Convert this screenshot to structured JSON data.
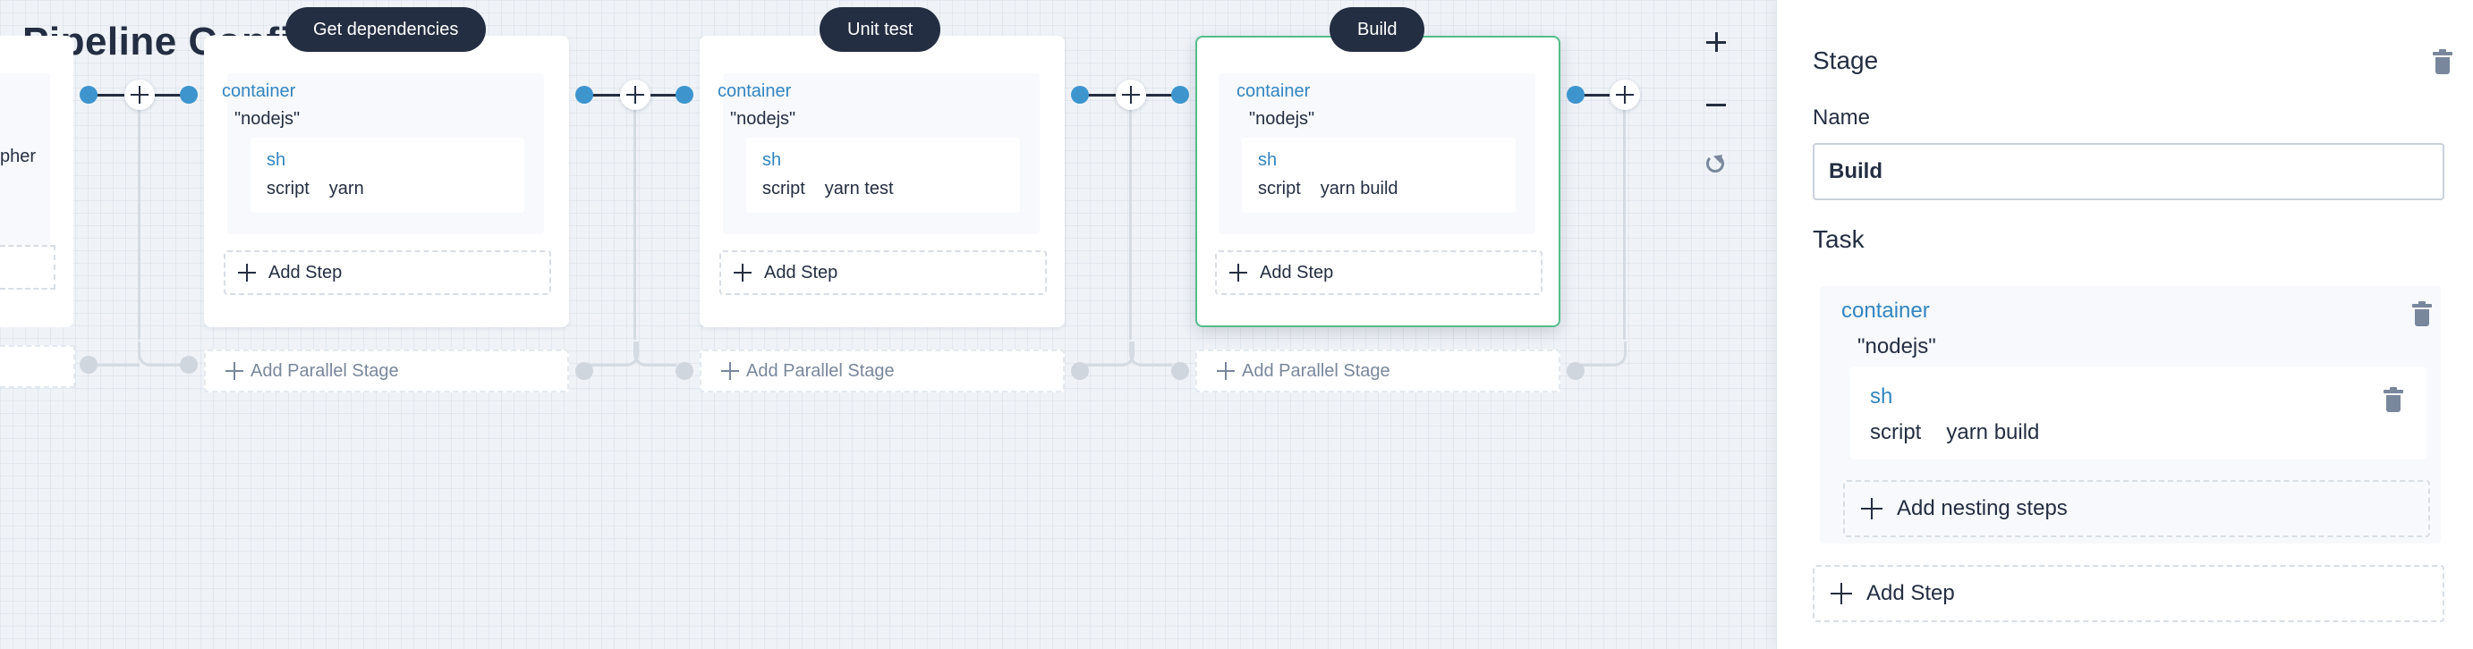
{
  "canvas": {
    "title_partial": "Pipeline Configuration",
    "zoom_in_label": "+",
    "zoom_out_label": "−",
    "partial_stage": {
      "text": "pher"
    },
    "stages": [
      {
        "name": "Get dependencies",
        "task_title": "container",
        "task_value": "\"nodejs\"",
        "step_title": "sh",
        "step_key": "script",
        "step_value": "yarn",
        "add_step": "Add Step",
        "add_parallel": "Add Parallel Stage",
        "selected": false
      },
      {
        "name": "Unit test",
        "task_title": "container",
        "task_value": "\"nodejs\"",
        "step_title": "sh",
        "step_key": "script",
        "step_value": "yarn test",
        "add_step": "Add Step",
        "add_parallel": "Add Parallel Stage",
        "selected": false
      },
      {
        "name": "Build",
        "task_title": "container",
        "task_value": "\"nodejs\"",
        "step_title": "sh",
        "step_key": "script",
        "step_value": "yarn build",
        "add_step": "Add Step",
        "add_parallel": "Add Parallel Stage",
        "selected": true
      }
    ]
  },
  "panel": {
    "heading": "Stage",
    "name_label": "Name",
    "name_value": "Build",
    "task_heading": "Task",
    "task": {
      "title": "container",
      "value": "\"nodejs\"",
      "step_title": "sh",
      "step_key": "script",
      "step_value": "yarn build",
      "add_nesting": "Add nesting steps"
    },
    "add_step": "Add Step"
  },
  "icons": [
    "plus-icon",
    "minus-icon",
    "refresh-icon",
    "trash-icon"
  ],
  "colors": {
    "link_blue": "#3385c0",
    "node_blue": "#3e95ce",
    "dark": "#242e42",
    "selected_border": "#55bc8a",
    "muted": "#79879c"
  }
}
